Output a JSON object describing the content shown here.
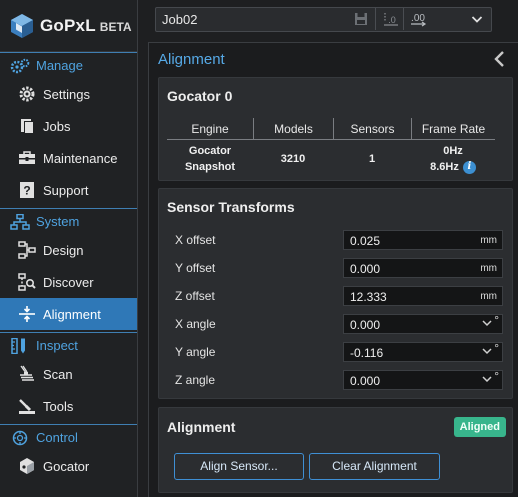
{
  "brand": {
    "name": "GoPxL",
    "beta": "BETA"
  },
  "sidebar": {
    "sections": [
      {
        "label": "Manage",
        "icon": "gears-icon",
        "items": [
          {
            "label": "Settings",
            "icon": "gear-icon"
          },
          {
            "label": "Jobs",
            "icon": "documents-icon"
          },
          {
            "label": "Maintenance",
            "icon": "toolbox-icon"
          },
          {
            "label": "Support",
            "icon": "help-icon"
          }
        ]
      },
      {
        "label": "System",
        "icon": "network-icon",
        "items": [
          {
            "label": "Design",
            "icon": "design-icon"
          },
          {
            "label": "Discover",
            "icon": "discover-icon"
          },
          {
            "label": "Alignment",
            "icon": "alignment-icon",
            "active": true
          }
        ]
      },
      {
        "label": "Inspect",
        "icon": "ruler-icon",
        "items": [
          {
            "label": "Scan",
            "icon": "scan-icon"
          },
          {
            "label": "Tools",
            "icon": "tools-icon"
          }
        ]
      },
      {
        "label": "Control",
        "icon": "control-icon",
        "items": [
          {
            "label": "Gocator",
            "icon": "gocator-icon"
          }
        ]
      }
    ]
  },
  "toolbar": {
    "job": "Job02"
  },
  "panel": {
    "title": "Alignment",
    "device": {
      "title": "Gocator 0",
      "columns": [
        "Engine",
        "Models",
        "Sensors",
        "Frame Rate"
      ],
      "row": {
        "engine_line1": "Gocator",
        "engine_line2": "Snapshot",
        "models": "3210",
        "sensors": "1",
        "rate_line1": "0Hz",
        "rate_line2": "8.6Hz"
      }
    },
    "transforms": {
      "title": "Sensor Transforms",
      "fields": [
        {
          "label": "X offset",
          "value": "0.025",
          "unit": "mm"
        },
        {
          "label": "Y offset",
          "value": "0.000",
          "unit": "mm"
        },
        {
          "label": "Z offset",
          "value": "12.333",
          "unit": "mm"
        },
        {
          "label": "X angle",
          "value": "0.000",
          "unit": "°"
        },
        {
          "label": "Y angle",
          "value": "-0.116",
          "unit": "°"
        },
        {
          "label": "Z angle",
          "value": "0.000",
          "unit": "°"
        }
      ]
    },
    "alignment": {
      "title": "Alignment",
      "status": "Aligned",
      "align_button": "Align Sensor...",
      "clear_button": "Clear Alignment"
    }
  },
  "colors": {
    "accent": "#2f78b7",
    "section": "#4fa3e0",
    "aligned": "#38b58c"
  }
}
